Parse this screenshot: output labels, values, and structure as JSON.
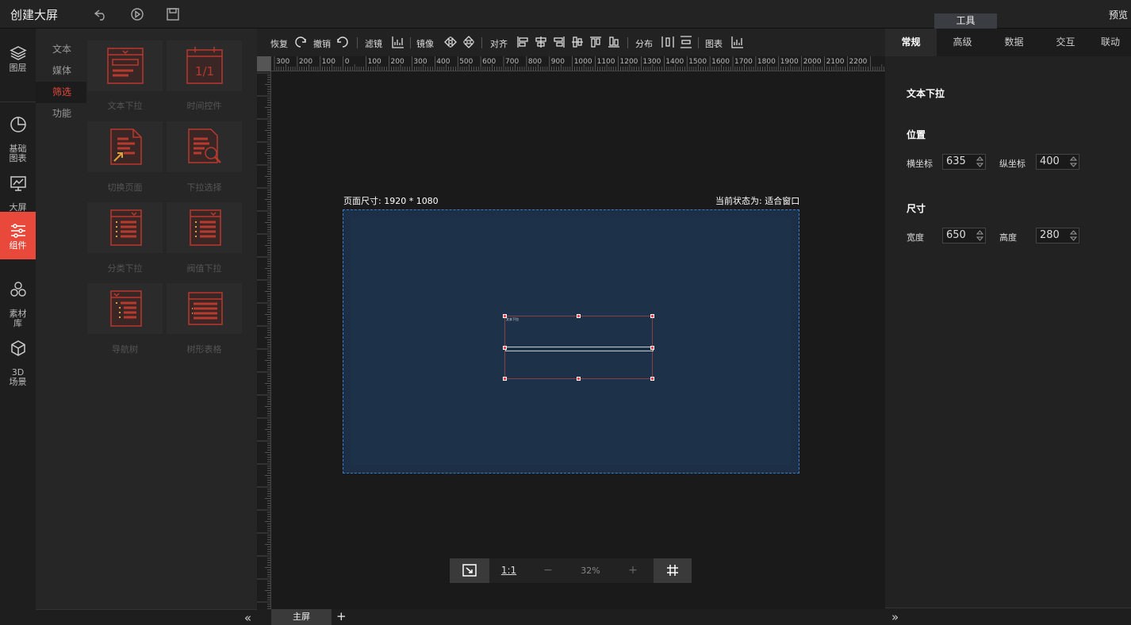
{
  "app": {
    "title": "创建大屏",
    "tools_tab": "工具",
    "preview_label": "预览",
    "icons": [
      "undo-icon",
      "play-icon",
      "save-icon"
    ]
  },
  "leftnav": {
    "items": [
      {
        "label": "图层",
        "icon": "layers-icon",
        "active": false
      },
      {
        "label": "基础\n图表",
        "icon": "pie-chart-icon",
        "active": false
      },
      {
        "label": "大屏\n图表",
        "icon": "screen-chart-icon",
        "active": false
      },
      {
        "label": "组件",
        "icon": "sliders-icon",
        "active": true
      },
      {
        "label": "素材\n库",
        "icon": "hexagons-icon",
        "active": false
      },
      {
        "label": "3D\n场景",
        "icon": "cube-icon",
        "active": false
      }
    ],
    "accent_color": "#e8493a"
  },
  "categories": [
    {
      "label": "文本",
      "active": false
    },
    {
      "label": "媒体",
      "active": false
    },
    {
      "label": "筛选",
      "active": true
    },
    {
      "label": "功能",
      "active": false
    }
  ],
  "components": [
    {
      "label": "文本下拉",
      "icon": "text-dropdown-icon"
    },
    {
      "label": "时间控件",
      "icon": "calendar-icon"
    },
    {
      "label": "切换页面",
      "icon": "switch-page-icon"
    },
    {
      "label": "下拉选择",
      "icon": "dropdown-search-icon"
    },
    {
      "label": "分类下拉",
      "icon": "category-dropdown-icon"
    },
    {
      "label": "阀值下拉",
      "icon": "threshold-dropdown-icon"
    },
    {
      "label": "导航树",
      "icon": "nav-tree-icon"
    },
    {
      "label": "树形表格",
      "icon": "tree-table-icon"
    }
  ],
  "calendar_text": "1/1",
  "toolbar": {
    "redo": "恢复",
    "undo": "撤销",
    "filter": "滤镜",
    "mirror": "镜像",
    "align": "对齐",
    "distribute": "分布",
    "chart": "图表"
  },
  "ruler_h_labels": [
    "300",
    "200",
    "100",
    "0",
    "100",
    "200",
    "300",
    "400",
    "500",
    "600",
    "700",
    "800",
    "900",
    "1000",
    "1100",
    "1200",
    "1300",
    "1400",
    "1500",
    "1600",
    "1700",
    "1800",
    "1900",
    "2000",
    "2100",
    "2200"
  ],
  "canvas": {
    "page_size_label": "页面尺寸: 1920 * 1080",
    "state_label": "当前状态为: 适合窗口",
    "widget_label": "文本下拉",
    "page_bg": "#1d3149",
    "frame_color": "#3c7cc4"
  },
  "zoombar": {
    "one_to_one": "1:1",
    "minus": "−",
    "zoom": "32%",
    "plus": "+"
  },
  "screens": {
    "tab": "主屏",
    "add": "+"
  },
  "rightpanel": {
    "tabs": [
      {
        "label": "常规",
        "active": true
      },
      {
        "label": "高级",
        "active": false
      },
      {
        "label": "数据",
        "active": false
      },
      {
        "label": "交互",
        "active": false
      },
      {
        "label": "联动",
        "active": false
      }
    ],
    "component_name": "文本下拉",
    "position_heading": "位置",
    "x_label": "横坐标",
    "x_value": "635",
    "y_label": "纵坐标",
    "y_value": "400",
    "size_heading": "尺寸",
    "w_label": "宽度",
    "w_value": "650",
    "h_label": "高度",
    "h_value": "280"
  },
  "collapse_left": "«",
  "collapse_right": "»"
}
